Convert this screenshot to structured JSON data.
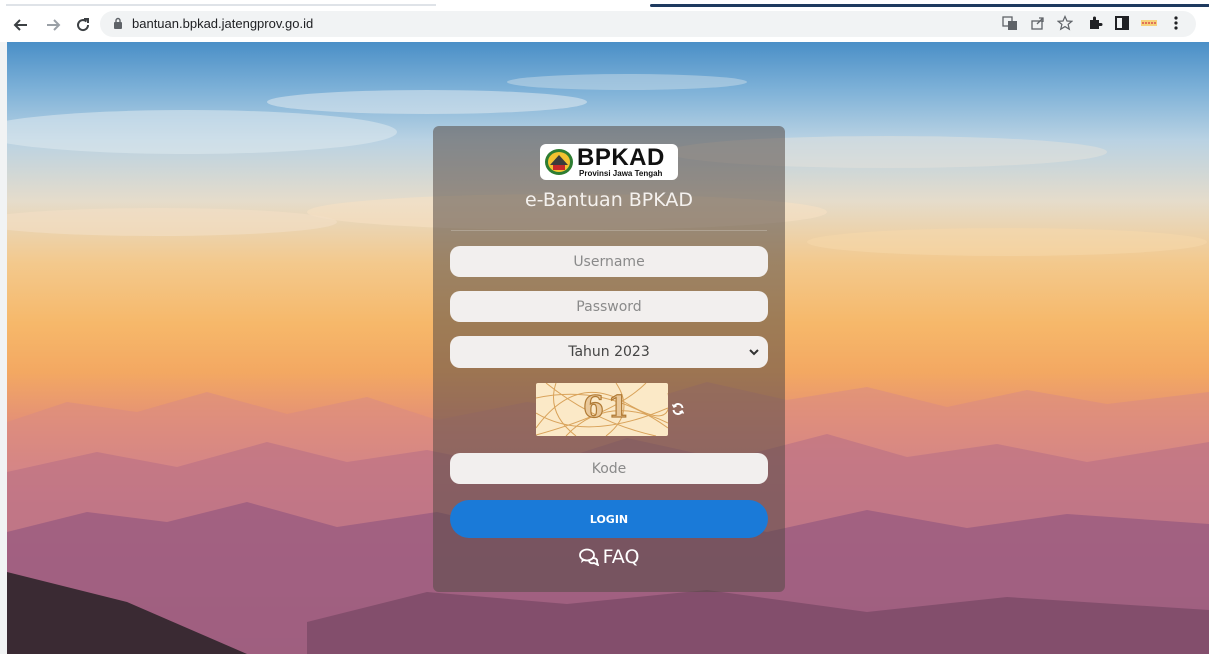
{
  "browser": {
    "url": "bantuan.bpkad.jatengprov.go.id",
    "back_icon": "arrow-left-icon",
    "forward_icon": "arrow-right-icon",
    "reload_icon": "reload-icon",
    "toolbar_icons": [
      "translate-icon",
      "share-icon",
      "star-icon",
      "extensions-icon",
      "sidepanel-icon",
      "profile-icon",
      "menu-icon"
    ]
  },
  "login": {
    "logo_text": "BPKAD",
    "logo_subtext": "Provinsi Jawa Tengah",
    "title": "e-Bantuan BPKAD",
    "username_placeholder": "Username",
    "password_placeholder": "Password",
    "year_selected": "Tahun 2023",
    "captcha_text": "61",
    "code_placeholder": "Kode",
    "login_label": "LOGIN",
    "faq_label": "FAQ"
  },
  "colors": {
    "login_button": "#1a7ad8",
    "card_overlay": "rgba(85,75,70,0.55)",
    "field_bg": "#f2efee"
  }
}
